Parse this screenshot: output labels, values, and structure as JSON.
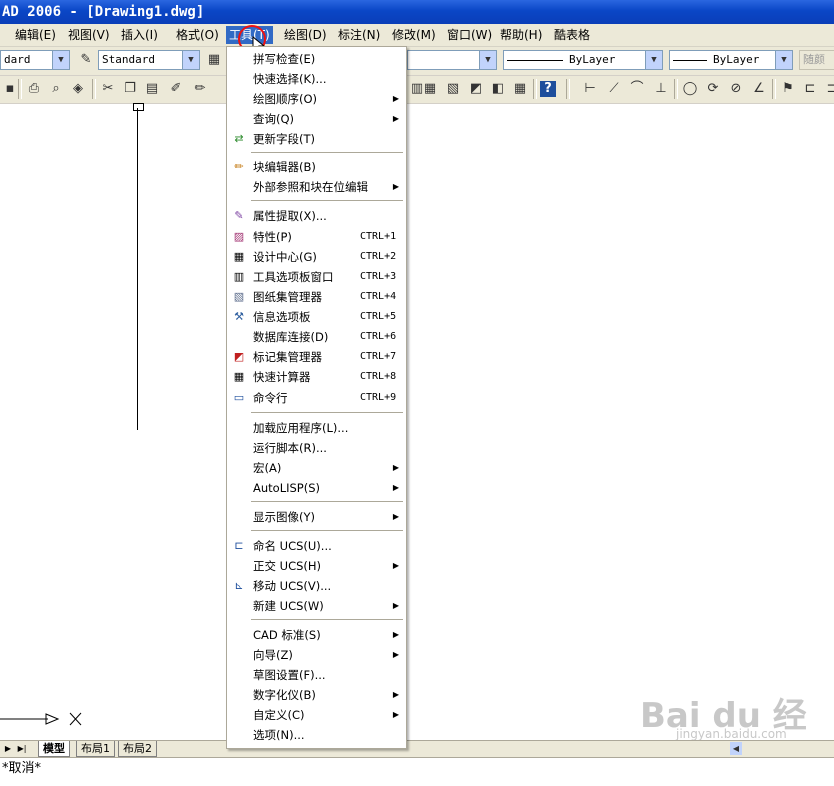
{
  "titlebar": {
    "title": "AD 2006 - [Drawing1.dwg]"
  },
  "menubar": {
    "items": [
      {
        "label": "编辑(E)"
      },
      {
        "label": "视图(V)"
      },
      {
        "label": "插入(I)"
      },
      {
        "label": "格式(O)"
      },
      {
        "label": "工具(T)"
      },
      {
        "label": "绘图(D)"
      },
      {
        "label": "标注(N)"
      },
      {
        "label": "修改(M)"
      },
      {
        "label": "窗口(W)"
      },
      {
        "label": "帮助(H)"
      },
      {
        "label": "酷表格"
      }
    ]
  },
  "toolbar": {
    "text_style": "dard",
    "dim_style": "Standard",
    "color_select": "ByLayer",
    "linetype_select": "ByLayer",
    "lineweight_select": "随颜"
  },
  "tools_menu": {
    "items": [
      {
        "label": "拼写检查(E)"
      },
      {
        "label": "快速选择(K)..."
      },
      {
        "label": "绘图顺序(O)",
        "submenu": "▶"
      },
      {
        "label": "查询(Q)",
        "submenu": "▶"
      },
      {
        "label": "更新字段(T)"
      },
      {
        "label": "块编辑器(B)"
      },
      {
        "label": "外部参照和块在位编辑",
        "submenu": "▶"
      },
      {
        "label": "属性提取(X)..."
      },
      {
        "label": "特性(P)",
        "shortcut": "CTRL+1"
      },
      {
        "label": "设计中心(G)",
        "shortcut": "CTRL+2"
      },
      {
        "label": "工具选项板窗口",
        "shortcut": "CTRL+3"
      },
      {
        "label": "图纸集管理器",
        "shortcut": "CTRL+4"
      },
      {
        "label": "信息选项板",
        "shortcut": "CTRL+5"
      },
      {
        "label": "数据库连接(D)",
        "shortcut": "CTRL+6"
      },
      {
        "label": "标记集管理器",
        "shortcut": "CTRL+7"
      },
      {
        "label": "快速计算器",
        "shortcut": "CTRL+8"
      },
      {
        "label": "命令行",
        "shortcut": "CTRL+9"
      },
      {
        "label": "加载应用程序(L)..."
      },
      {
        "label": "运行脚本(R)..."
      },
      {
        "label": "宏(A)",
        "submenu": "▶"
      },
      {
        "label": "AutoLISP(S)",
        "submenu": "▶"
      },
      {
        "label": "显示图像(Y)",
        "submenu": "▶"
      },
      {
        "label": "命名 UCS(U)..."
      },
      {
        "label": "正交 UCS(H)",
        "submenu": "▶"
      },
      {
        "label": "移动 UCS(V)..."
      },
      {
        "label": "新建 UCS(W)",
        "submenu": "▶"
      },
      {
        "label": "CAD 标准(S)",
        "submenu": "▶"
      },
      {
        "label": "向导(Z)",
        "submenu": "▶"
      },
      {
        "label": "草图设置(F)..."
      },
      {
        "label": "数字化仪(B)",
        "submenu": "▶"
      },
      {
        "label": "自定义(C)",
        "submenu": "▶"
      },
      {
        "label": "选项(N)..."
      }
    ]
  },
  "layout_tabs": {
    "model": "模型",
    "layout1": "布局1",
    "layout2": "布局2"
  },
  "command_line": {
    "text": "*取消*"
  },
  "watermark": {
    "brand": "Bai du 经验",
    "url": "jingyan.baidu.com"
  }
}
